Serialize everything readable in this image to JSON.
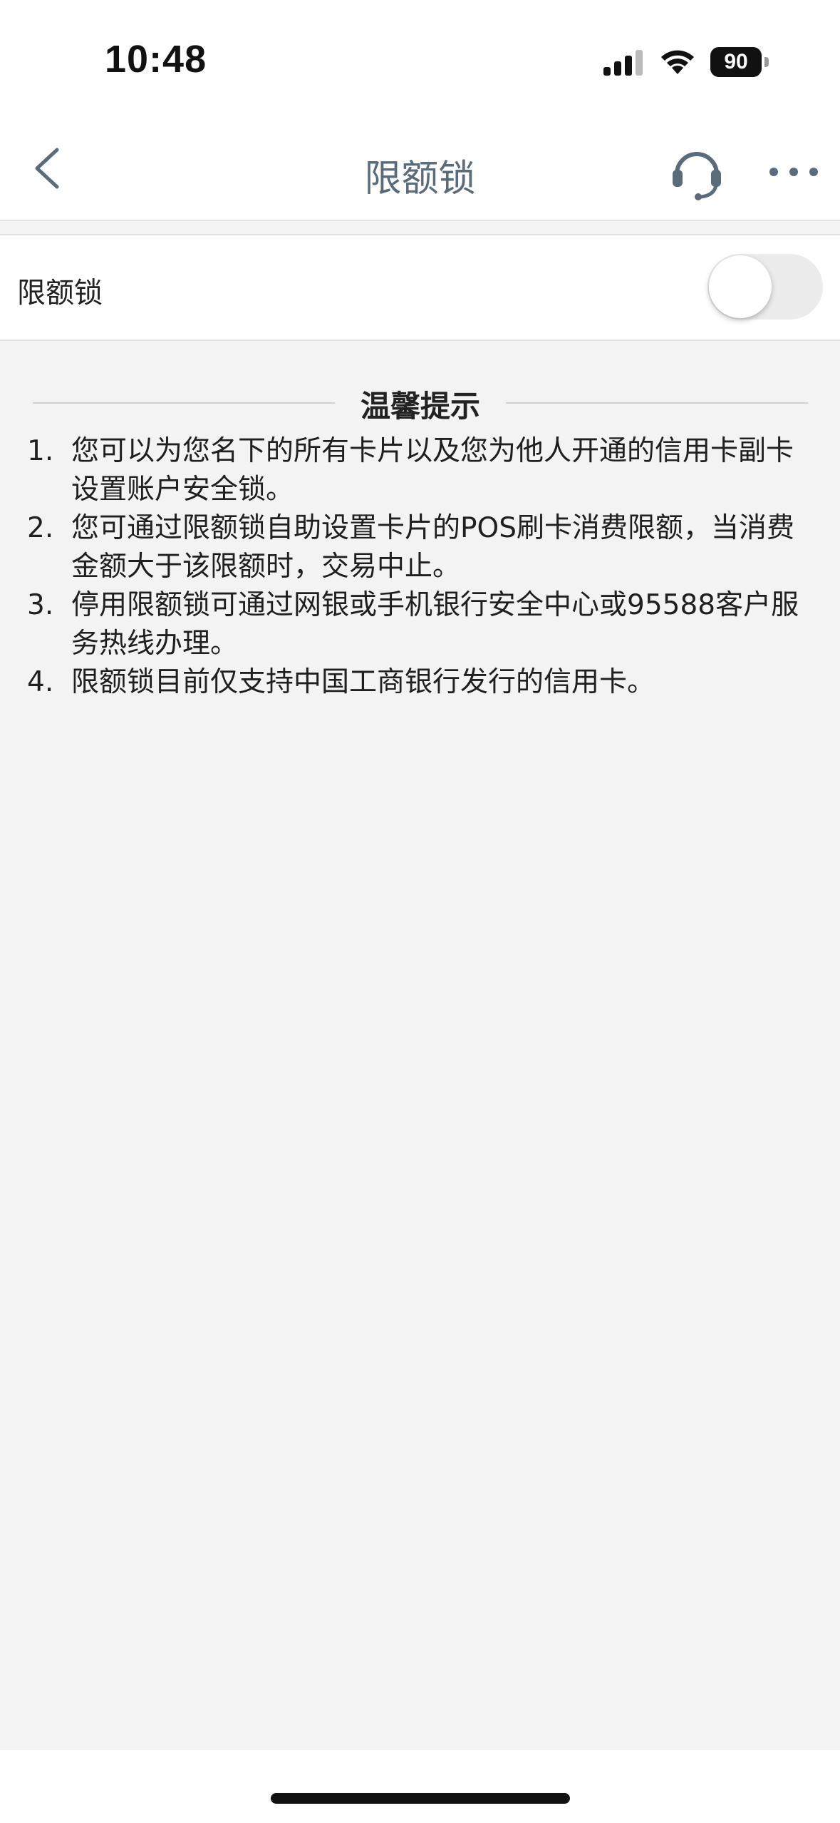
{
  "status_bar": {
    "time": "10:48",
    "battery": "90",
    "icons": [
      "signal-icon",
      "wifi-icon",
      "battery-icon"
    ]
  },
  "nav": {
    "title": "限额锁",
    "back_icon": "chevron-left-icon",
    "service_icon": "headset-icon",
    "more_icon": "more-dots-icon"
  },
  "setting": {
    "label": "限额锁",
    "enabled": false
  },
  "tips": {
    "title": "温馨提示",
    "items": [
      {
        "num": "1.",
        "text": "您可以为您名下的所有卡片以及您为他人开通的信用卡副卡设置账户安全锁。"
      },
      {
        "num": "2.",
        "text": "您可通过限额锁自助设置卡片的POS刷卡消费限额，当消费金额大于该限额时，交易中止。"
      },
      {
        "num": "3.",
        "text": "停用限额锁可通过网银或手机银行安全中心或95588客户服务热线办理。"
      },
      {
        "num": "4.",
        "text": "限额锁目前仅支持中国工商银行发行的信用卡。"
      }
    ]
  },
  "colors": {
    "background": "#f3f3f3",
    "nav_title": "#5a6b7c",
    "toggle_off": "#ececec"
  }
}
